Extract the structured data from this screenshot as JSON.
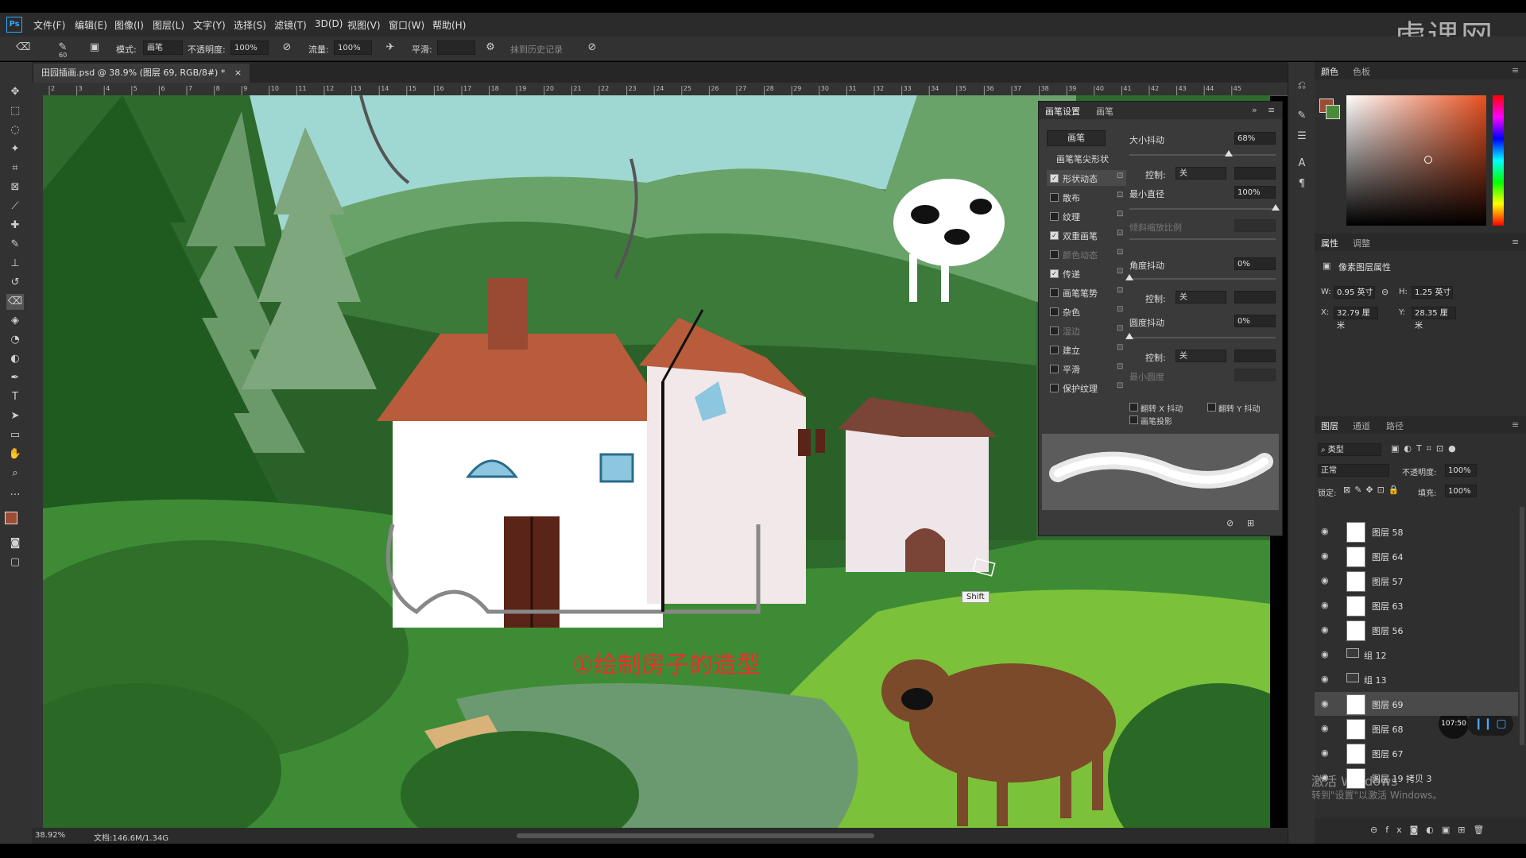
{
  "app": {
    "logo": "Ps"
  },
  "menu": [
    "文件(F)",
    "编辑(E)",
    "图像(I)",
    "图层(L)",
    "文字(Y)",
    "选择(S)",
    "滤镜(T)",
    "3D(D)",
    "视图(V)",
    "窗口(W)",
    "帮助(H)"
  ],
  "watermark": "虎课网",
  "options": {
    "brush_size": "60",
    "mode_label": "模式:",
    "mode_value": "画笔",
    "opacity_label": "不透明度:",
    "opacity_value": "100%",
    "flow_label": "流量:",
    "flow_value": "100%",
    "smooth_label": "平滑:",
    "history_label": "抹到历史记录"
  },
  "document": {
    "tab_title": "田园插画.psd @ 38.9% (图层 69, RGB/8#) *",
    "close": "×"
  },
  "ruler_ticks": [
    "2",
    "3",
    "4",
    "5",
    "6",
    "7",
    "8",
    "9",
    "10",
    "11",
    "12",
    "13",
    "14",
    "15",
    "16",
    "17",
    "18",
    "19",
    "20",
    "21",
    "22",
    "23",
    "24",
    "25",
    "26",
    "27",
    "28",
    "29",
    "30",
    "31",
    "32",
    "33",
    "34",
    "35",
    "36",
    "37",
    "38",
    "39",
    "40",
    "41",
    "42",
    "43",
    "44",
    "45"
  ],
  "canvas": {
    "caption": "①绘制房子的造型",
    "shift_tooltip": "Shift"
  },
  "status": {
    "zoom": "38.92%",
    "doc": "文档:146.6M/1.34G"
  },
  "brush_panel": {
    "tabs": [
      "画笔设置",
      "画笔"
    ],
    "brush_button": "画笔",
    "tip_shape": "画笔笔尖形状",
    "options": [
      {
        "label": "形状动态",
        "checked": true,
        "active": true,
        "dim": false
      },
      {
        "label": "散布",
        "checked": false,
        "active": false,
        "dim": false
      },
      {
        "label": "纹理",
        "checked": false,
        "active": false,
        "dim": false
      },
      {
        "label": "双重画笔",
        "checked": true,
        "active": false,
        "dim": false
      },
      {
        "label": "颜色动态",
        "checked": false,
        "active": false,
        "dim": true
      },
      {
        "label": "传递",
        "checked": true,
        "active": false,
        "dim": false
      },
      {
        "label": "画笔笔势",
        "checked": false,
        "active": false,
        "dim": false
      },
      {
        "label": "杂色",
        "checked": false,
        "active": false,
        "dim": false
      },
      {
        "label": "湿边",
        "checked": false,
        "active": false,
        "dim": true
      },
      {
        "label": "建立",
        "checked": false,
        "active": false,
        "dim": false
      },
      {
        "label": "平滑",
        "checked": false,
        "active": false,
        "dim": false
      },
      {
        "label": "保护纹理",
        "checked": false,
        "active": false,
        "dim": false
      }
    ],
    "size_jitter_label": "大小抖动",
    "size_jitter_value": "68%",
    "control_label": "控制:",
    "control_value": "关",
    "min_diameter_label": "最小直径",
    "min_diameter_value": "100%",
    "tilt_scale_label": "倾斜缩放比例",
    "angle_jitter_label": "角度抖动",
    "angle_jitter_value": "0%",
    "roundness_jitter_label": "圆度抖动",
    "roundness_jitter_value": "0%",
    "min_roundness_label": "最小圆度",
    "flip_x": "翻转 X 抖动",
    "flip_y": "翻转 Y 抖动",
    "brush_projection": "画笔投影",
    "size_jitter_level": 0.68,
    "min_diameter_level": 1.0
  },
  "color_panel": {
    "tabs": [
      "颜色",
      "色板"
    ],
    "fg": "#9a4d33",
    "bg": "#4b8a3a"
  },
  "properties_panel": {
    "tabs": [
      "属性",
      "调整"
    ],
    "title": "像素图层属性",
    "w_label": "W:",
    "w_value": "0.95 英寸",
    "h_label": "H:",
    "h_value": "1.25 英寸",
    "x_label": "X:",
    "x_value": "32.79 厘米",
    "y_label": "Y:",
    "y_value": "28.35 厘米"
  },
  "layers_panel": {
    "tabs": [
      "图层",
      "通道",
      "路径"
    ],
    "filter": "类型",
    "blend": "正常",
    "opacity_label": "不透明度:",
    "opacity_value": "100%",
    "lock_label": "锁定:",
    "fill_label": "填充:",
    "fill_value": "100%",
    "layers": [
      {
        "name": "图层 58",
        "type": "layer",
        "selected": false
      },
      {
        "name": "图层 64",
        "type": "layer",
        "selected": false
      },
      {
        "name": "图层 57",
        "type": "layer",
        "selected": false
      },
      {
        "name": "图层 63",
        "type": "layer",
        "selected": false
      },
      {
        "name": "图层 56",
        "type": "layer",
        "selected": false
      },
      {
        "name": "组 12",
        "type": "group",
        "selected": false
      },
      {
        "name": "组 13",
        "type": "group",
        "selected": false
      },
      {
        "name": "图层 69",
        "type": "layer",
        "selected": true
      },
      {
        "name": "图层 68",
        "type": "layer",
        "selected": false
      },
      {
        "name": "图层 67",
        "type": "layer",
        "selected": false
      },
      {
        "name": "图层 19 拷贝 3",
        "type": "layer",
        "selected": false
      }
    ],
    "timer": "107:50"
  },
  "windows_activation": {
    "line1": "激活 Windows",
    "line2": "转到\"设置\"以激活 Windows。"
  }
}
